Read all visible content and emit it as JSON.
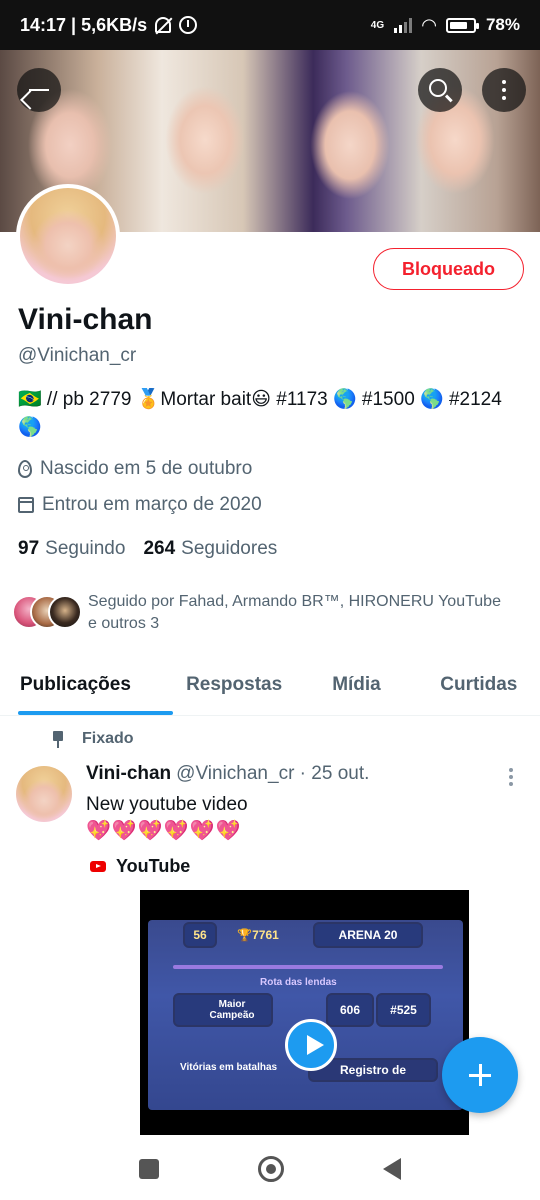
{
  "status_bar": {
    "time_speed": "14:17 | 5,6KB/s",
    "network": "4G",
    "battery": "78%",
    "battery_level": 0.78
  },
  "profile": {
    "name": "Vini-chan",
    "handle": "@Vinichan_cr",
    "bio": "🇧🇷 // pb 2779 🏅Mortar bait😃  #1173 🌎 #1500 🌎 #2124🌎",
    "location": "Nascido em 5 de outubro",
    "joined": "Entrou em março de 2020",
    "following_count": "97",
    "following_label": "Seguindo",
    "followers_count": "264",
    "followers_label": "Seguidores",
    "followed_by": "Seguido por Fahad, Armando BR™, HIRONERU YouTube e outros 3",
    "blocked_label": "Bloqueado"
  },
  "tabs": [
    {
      "label": "Publicações",
      "active": true
    },
    {
      "label": "Respostas",
      "active": false
    },
    {
      "label": "Mídia",
      "active": false
    },
    {
      "label": "Curtidas",
      "active": false
    }
  ],
  "pinned_tweet": {
    "pinned_label": "Fixado",
    "author_name": "Vini-chan",
    "author_meta": "@Vinichan_cr · 25 out.",
    "text": "New youtube video",
    "emojis": "💖💖💖💖💖💖",
    "link_source": "YouTube",
    "video": {
      "level": "56",
      "trophies": "7761",
      "arena": "ARENA 20",
      "path": "Rota das lendas",
      "rank_title": "Maior Campeão",
      "rank_value": "606",
      "rank_num": "#525",
      "wins_label": "Vitórias em batalhas",
      "log_label": "Registro de"
    }
  },
  "colors": {
    "accent": "#1d9bf0",
    "blocked": "#f4212e",
    "secondary_text": "#536471"
  },
  "icons": [
    "back-arrow-icon",
    "search-icon",
    "more-vert-icon",
    "location-icon",
    "calendar-icon",
    "pin-icon",
    "youtube-icon",
    "play-icon",
    "compose-plus-icon"
  ]
}
